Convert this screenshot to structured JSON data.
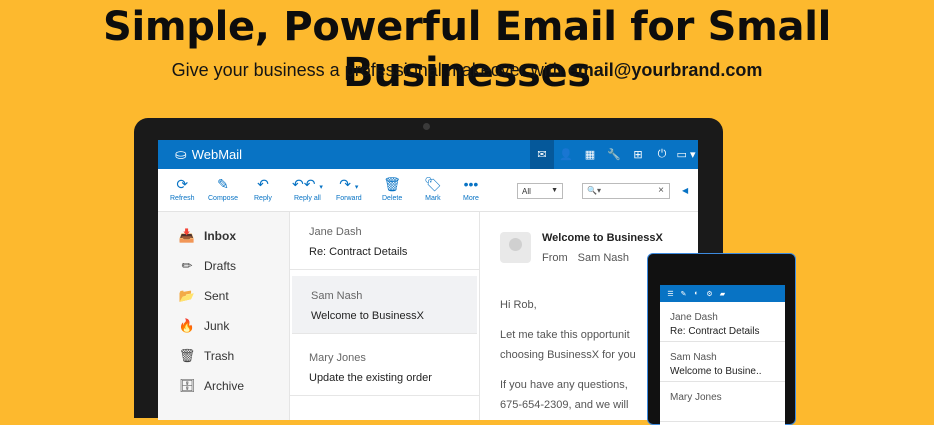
{
  "hero": {
    "headline": "Simple, Powerful Email for Small Businesses",
    "subline_prefix": "Give your business a professional makeover with ",
    "subline_email": "email@yourbrand.com"
  },
  "webmail": {
    "brand": "WebMail",
    "toolbar": {
      "refresh": "Refresh",
      "compose": "Compose",
      "reply": "Reply",
      "reply_all": "Reply all",
      "forward": "Forward",
      "delete": "Delete",
      "mark": "Mark",
      "more": "More",
      "select_value": "All"
    },
    "folders": [
      {
        "label": "Inbox",
        "icon": "inbox-icon"
      },
      {
        "label": "Drafts",
        "icon": "pencil-icon"
      },
      {
        "label": "Sent",
        "icon": "folder-open-icon"
      },
      {
        "label": "Junk",
        "icon": "fire-icon"
      },
      {
        "label": "Trash",
        "icon": "trash-icon"
      },
      {
        "label": "Archive",
        "icon": "archive-icon"
      }
    ],
    "messages": [
      {
        "from": "Jane Dash",
        "subject": "Re: Contract Details"
      },
      {
        "from": "Sam Nash",
        "subject": "Welcome to BusinessX"
      },
      {
        "from": "Mary Jones",
        "subject": "Update the existing order"
      }
    ],
    "reader": {
      "subject": "Welcome to BusinessX",
      "from_label": "From",
      "from_name": "Sam Nash",
      "greeting": "Hi Rob,",
      "body_line1": "Let me take this opportunit",
      "body_line2": "choosing BusinessX for you",
      "body_line3": "If you have any questions,",
      "body_line4": "675-654-2309, and we will"
    }
  },
  "phone": {
    "messages": [
      {
        "from": "Jane Dash",
        "subject": "Re: Contract Details"
      },
      {
        "from": "Sam Nash",
        "subject": "Welcome to Busine.."
      },
      {
        "from": "Mary Jones",
        "subject": ""
      }
    ]
  }
}
